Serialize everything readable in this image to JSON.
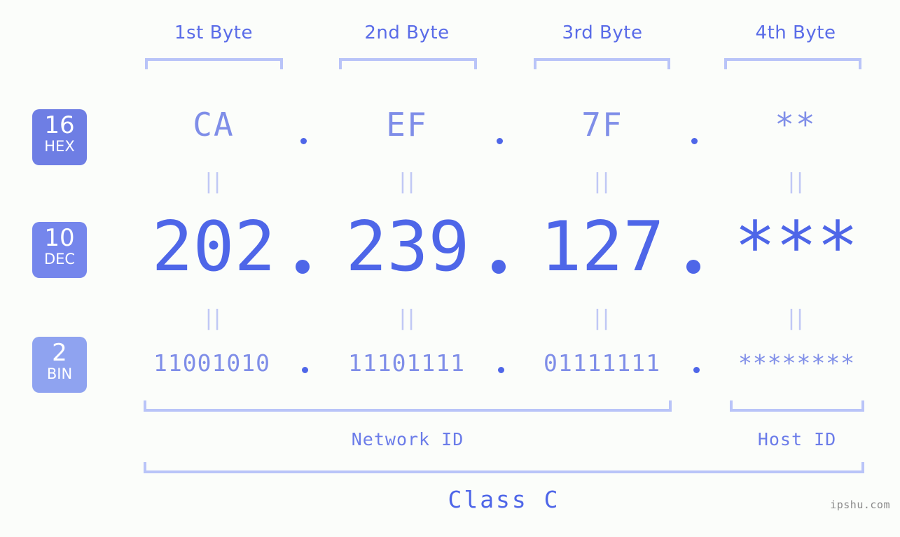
{
  "headers": [
    {
      "label": "1st Byte"
    },
    {
      "label": "2nd Byte"
    },
    {
      "label": "3rd Byte"
    },
    {
      "label": "4th Byte"
    }
  ],
  "bases": [
    {
      "number": "16",
      "name": "HEX",
      "color": "#6e7ee4"
    },
    {
      "number": "10",
      "name": "DEC",
      "color": "#7586ec"
    },
    {
      "number": "2",
      "name": "BIN",
      "color": "#8fa3f0"
    }
  ],
  "rows": {
    "hex": {
      "b1": "CA",
      "b2": "EF",
      "b3": "7F",
      "b4": "**"
    },
    "dec": {
      "b1": "202",
      "b2": "239",
      "b3": "127",
      "b4": "***"
    },
    "bin": {
      "b1": "11001010",
      "b2": "11101111",
      "b3": "01111111",
      "b4": "********"
    }
  },
  "separator": ".",
  "equals_glyph": "||",
  "regions": {
    "network_id": "Network ID",
    "host_id": "Host ID",
    "class": "Class C"
  },
  "watermark": "ipshu.com",
  "colors": {
    "background": "#fbfdfa",
    "accent_strong": "#4e66e8",
    "accent_mid": "#7f8ee8",
    "accent_light": "#b9c4f8",
    "equals": "#c0c8f5",
    "header_text": "#5a6ce8",
    "watermark": "#8a8a8a"
  }
}
